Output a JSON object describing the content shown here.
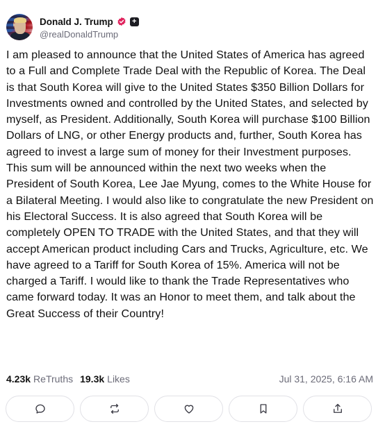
{
  "author": {
    "display_name": "Donald J. Trump",
    "handle": "@realDonaldTrump",
    "verified_badge_color": "#e0245e"
  },
  "post": {
    "text": "I am pleased to announce that the United States of America has agreed to a Full and Complete Trade Deal with the Republic of Korea. The Deal is that South Korea will give to the United States $350 Billion Dollars for Investments owned and controlled by the United States, and selected by myself, as President. Additionally, South Korea will purchase $100 Billion Dollars of LNG, or other Energy products and, further, South Korea has agreed to invest a large sum of money for their Investment purposes. This sum will be announced within the next two weeks when the President of South Korea, Lee Jae Myung, comes to the White House for a Bilateral Meeting. I would also like to congratulate the new President on his Electoral Success. It is also agreed that South Korea will be completely OPEN TO TRADE with the United States, and that they will accept American product including Cars and Trucks, Agriculture, etc. We have agreed to a Tariff for South Korea of 15%. America will not be charged a Tariff. I would like to thank the Trade Representatives who came forward today. It was an Honor to meet them, and talk about the Great Success of their Country!"
  },
  "stats": {
    "retruths_count": "4.23k",
    "retruths_label": "ReTruths",
    "likes_count": "19.3k",
    "likes_label": "Likes",
    "timestamp": "Jul 31, 2025, 6:16 AM"
  },
  "actions": [
    {
      "icon": "comment-icon"
    },
    {
      "icon": "retruth-icon"
    },
    {
      "icon": "heart-icon"
    },
    {
      "icon": "bookmark-icon"
    },
    {
      "icon": "share-icon"
    }
  ]
}
